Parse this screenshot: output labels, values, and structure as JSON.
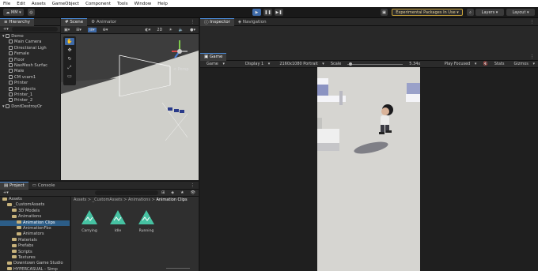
{
  "menu": [
    "File",
    "Edit",
    "Assets",
    "GameObject",
    "Component",
    "Tools",
    "Window",
    "Help"
  ],
  "toolbar": {
    "account": "MM",
    "experimental": "Experimental Packages In Use",
    "layers": "Layers",
    "layout": "Layout"
  },
  "hierarchy": {
    "tab": "Hierarchy",
    "items": [
      {
        "label": "Demo",
        "depth": 0
      },
      {
        "label": "Main Camera",
        "depth": 1
      },
      {
        "label": "Directional Ligh",
        "depth": 1
      },
      {
        "label": "Female",
        "depth": 1
      },
      {
        "label": "Floor",
        "depth": 1
      },
      {
        "label": "NavMesh Surfac",
        "depth": 1
      },
      {
        "label": "Male",
        "depth": 1
      },
      {
        "label": "CM vcam1",
        "depth": 1
      },
      {
        "label": "Printer",
        "depth": 1
      },
      {
        "label": "3d objects",
        "depth": 1
      },
      {
        "label": "Printer_1",
        "depth": 1
      },
      {
        "label": "Printer_2",
        "depth": 1
      },
      {
        "label": "DontDestroyOr",
        "depth": 0
      }
    ]
  },
  "scene": {
    "tabs": [
      "Scene",
      "Animator"
    ],
    "mode": "2D",
    "persp": "< Persp"
  },
  "inspector": {
    "tabs": [
      "Inspector",
      "Navigation"
    ]
  },
  "game": {
    "tab": "Game",
    "mode": "Game",
    "display": "Display 1",
    "resolution": "2160x1080 Portrait",
    "scale_label": "Scale",
    "scale_value": "5.34x",
    "play_focused": "Play Focused",
    "stats": "Stats",
    "gizmos": "Gizmos"
  },
  "project": {
    "tabs": [
      "Project",
      "Console"
    ],
    "tree": [
      {
        "label": "Assets",
        "depth": 0
      },
      {
        "label": "_CustomAssets",
        "depth": 1
      },
      {
        "label": "3D Models",
        "depth": 2
      },
      {
        "label": "Animations",
        "depth": 2
      },
      {
        "label": "Animation Clips",
        "depth": 3,
        "selected": true
      },
      {
        "label": "AnimationFbx",
        "depth": 3
      },
      {
        "label": "Animators",
        "depth": 3
      },
      {
        "label": "Materials",
        "depth": 2
      },
      {
        "label": "Prefabs",
        "depth": 2
      },
      {
        "label": "Scripts",
        "depth": 2
      },
      {
        "label": "Textures",
        "depth": 2
      },
      {
        "label": "Downtown Game Studio",
        "depth": 1
      },
      {
        "label": "HYPERCASUAL - Simp",
        "depth": 1
      }
    ],
    "breadcrumb": [
      "Assets",
      "_CustomAssets",
      "Animations",
      "Animation Clips"
    ],
    "assets": [
      "Carrying",
      "Idle",
      "Running"
    ]
  },
  "colors": {
    "accent": "#4a8ad6",
    "clip": "#46c2a2",
    "folder": "#c7b27b"
  }
}
